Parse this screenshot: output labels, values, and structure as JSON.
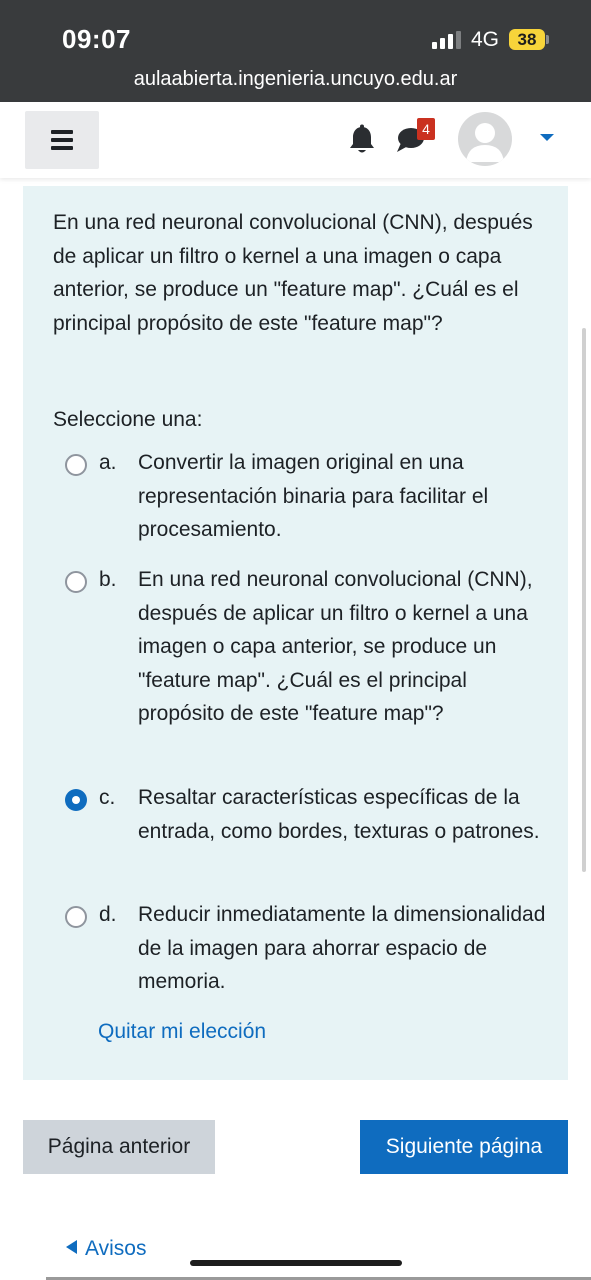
{
  "status_bar": {
    "time": "09:07",
    "network": "4G",
    "battery": "38"
  },
  "browser": {
    "url": "aulaabierta.ingenieria.uncuyo.edu.ar"
  },
  "navbar": {
    "messages_badge": "4",
    "icons": [
      "menu-icon",
      "bell-icon",
      "chat-icon",
      "avatar",
      "chevron-down-icon"
    ]
  },
  "question": {
    "text": "En una red neuronal convolucional (CNN), después de aplicar un filtro o kernel a una imagen o capa anterior, se produce un \"feature map\". ¿Cuál es el principal propósito de este \"feature map\"?",
    "prompt": "Seleccione una:",
    "selected": "c",
    "options": [
      {
        "letter": "a.",
        "text": "Convertir la imagen original en una representación binaria para facilitar el procesamiento."
      },
      {
        "letter": "b.",
        "text": "En una red neuronal convolucional (CNN), después de aplicar un filtro o kernel a una imagen o capa anterior, se produce un \"feature map\". ¿Cuál es el principal propósito de este \"feature map\"?"
      },
      {
        "letter": "c.",
        "text": "Resaltar características específicas de la entrada, como bordes, texturas o patrones."
      },
      {
        "letter": "d.",
        "text": "Reducir inmediatamente la dimensionalidad de la imagen para ahorrar espacio de memoria."
      }
    ],
    "clear_label": "Quitar mi elección"
  },
  "navigation": {
    "prev_label": "Página anterior",
    "next_label": "Siguiente página"
  },
  "footer": {
    "avisos_label": "Avisos"
  },
  "colors": {
    "accent": "#0f6cbf",
    "question_bg": "#e7f3f5",
    "badge": "#ca3120",
    "status_bar_bg": "#393b3d"
  }
}
